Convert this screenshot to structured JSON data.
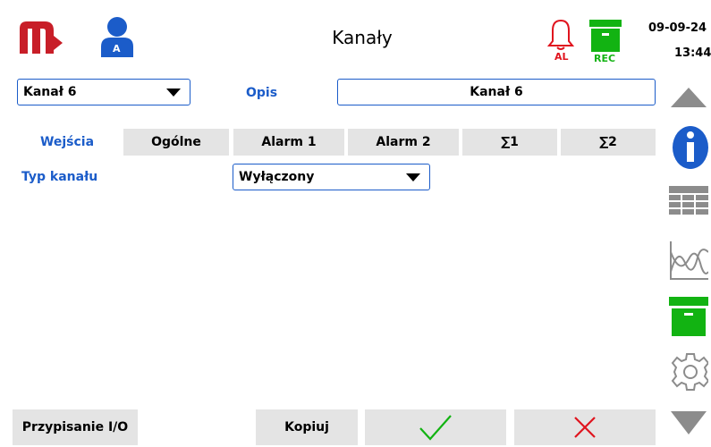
{
  "header": {
    "title": "Kanały",
    "user_badge": "A",
    "alarm_label": "AL",
    "rec_label": "REC",
    "date": "09-09-24",
    "time": "13:44"
  },
  "channel": {
    "selected": "Kanał 6",
    "description_label": "Opis",
    "description_value": "Kanał 6"
  },
  "tabs": [
    {
      "label": "Wejścia",
      "active": true
    },
    {
      "label": "Ogólne",
      "active": false
    },
    {
      "label": "Alarm 1",
      "active": false
    },
    {
      "label": "Alarm 2",
      "active": false
    },
    {
      "label": "∑1",
      "active": false
    },
    {
      "label": "∑2",
      "active": false
    }
  ],
  "inputs": {
    "type_label": "Typ kanału",
    "type_value": "Wyłączony"
  },
  "footer": {
    "io_assign_label": "Przypisanie I/O",
    "copy_label": "Kopiuj"
  },
  "colors": {
    "accent_blue": "#1b5cc9",
    "brand_red": "#c81e28",
    "ok_green": "#12b312",
    "cancel_red": "#e0141e",
    "button_gray": "#e4e4e4",
    "icon_gray": "#8c8c8c"
  },
  "icons": [
    "logo-m-icon",
    "user-icon",
    "alarm-bell-icon",
    "rec-archive-icon",
    "scroll-up-icon",
    "info-icon",
    "table-view-icon",
    "trend-chart-icon",
    "archive-icon",
    "settings-gear-icon",
    "scroll-down-icon",
    "confirm-check-icon",
    "cancel-x-icon"
  ]
}
